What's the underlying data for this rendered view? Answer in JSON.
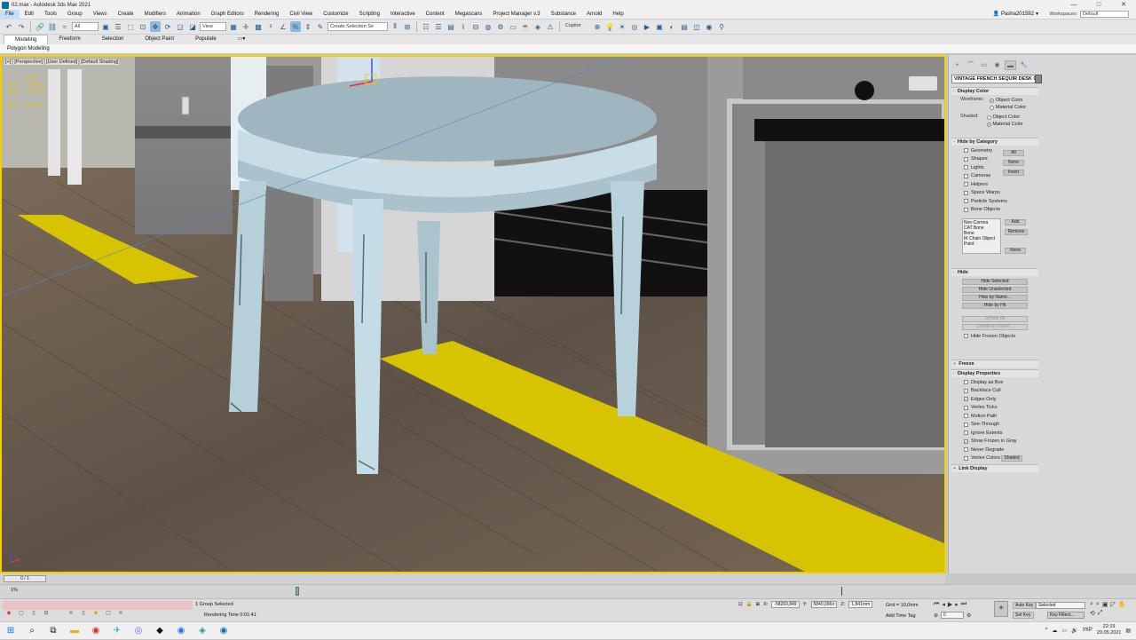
{
  "window": {
    "title": "02.max - Autodesk 3ds Max 2021",
    "min": "—",
    "max": "□",
    "close": "✕"
  },
  "menu": {
    "items": [
      "File",
      "Edit",
      "Tools",
      "Group",
      "Views",
      "Create",
      "Modifiers",
      "Animation",
      "Graph Editors",
      "Rendering",
      "Civil View",
      "Customize",
      "Scripting",
      "Interactive",
      "Content",
      "Megascans",
      "Project Manager v.3",
      "Substance",
      "Arnold",
      "Help"
    ],
    "user": "Pasha201592",
    "workspaces_label": "Workspaces:",
    "workspace": "Default"
  },
  "toolbar": {
    "filter": "All",
    "refcoord": "View",
    "selection_set": "Create Selection Se",
    "copitor": "Copitor"
  },
  "ribbon": {
    "tabs": [
      "Modeling",
      "Freeform",
      "Selection",
      "Object Paint",
      "Populate"
    ],
    "sub": "Polygon Modeling"
  },
  "viewport": {
    "labels": [
      "[+]",
      "[Perspective]",
      "[User Defined]",
      "[Default Shading]"
    ],
    "stats": {
      "total_label": "Total",
      "polys_label": "Polys:",
      "polys": "9 954 72",
      "verts_label": "Verts:",
      "verts": "8 704 95",
      "fps_label": "FPS:",
      "fps": "Inactive"
    },
    "colors": {
      "highlight": "#f0d000",
      "floor": "#6a5e52"
    }
  },
  "cmd": {
    "tabs": [
      "+",
      "⌒",
      "▭",
      "◉",
      "▬",
      "🔧"
    ],
    "object_name": "VINTAGE FRENCH SEQUIR DESK C",
    "display_color": {
      "title": "Display Color",
      "wireframe_label": "Wireframe:",
      "shaded_label": "Shaded:",
      "object_color": "Object Color",
      "material_color": "Material Color"
    },
    "hide_by_category": {
      "title": "Hide by Category",
      "items": [
        "Geometry",
        "Shapes",
        "Lights",
        "Cameras",
        "Helpers",
        "Space Warps",
        "Particle Systems",
        "Bone Objects"
      ],
      "buttons": [
        "All",
        "None",
        "Invert"
      ],
      "list": [
        "Non-Corona",
        "CAT Bone",
        "Bone",
        "IK Chain Object",
        "Point"
      ],
      "list_buttons": [
        "Add",
        "Remove",
        "None"
      ]
    },
    "hide": {
      "title": "Hide",
      "buttons": [
        "Hide Selected",
        "Hide Unselected",
        "Hide by Name...",
        "Hide by Hit"
      ],
      "disabled_buttons": [
        "Unhide All",
        "Unhide by Name..."
      ],
      "frozen": "Hide Frozen Objects"
    },
    "freeze": {
      "title": "Freeze"
    },
    "display_properties": {
      "title": "Display Properties",
      "items": [
        {
          "label": "Display as Box",
          "on": false
        },
        {
          "label": "Backface Cull",
          "on": false
        },
        {
          "label": "Edges Only",
          "on": true
        },
        {
          "label": "Vertex Ticks",
          "on": false
        },
        {
          "label": "Motion Path",
          "on": false
        },
        {
          "label": "See-Through",
          "on": false
        },
        {
          "label": "Ignore Extents",
          "on": false
        },
        {
          "label": "Show Frozen in Gray",
          "on": true
        },
        {
          "label": "Never Degrade",
          "on": false
        },
        {
          "label": "Vertex Colors",
          "on": false
        }
      ],
      "shaded_btn": "Shaded"
    },
    "link_display": {
      "title": "Link Display"
    }
  },
  "timeline": {
    "slider": "0 / 1",
    "pct": "1%"
  },
  "status": {
    "selected": "1 Group Selected",
    "render_time": "Rendering Time  0:01:41",
    "x_label": "X:",
    "x": "-58260,849",
    "y_label": "Y:",
    "y": "5840,096ır",
    "z_label": "Z:",
    "z": "1,841mm",
    "grid": "Grid = 10,0mm",
    "add_time_tag": "Add Time Tag",
    "frame": "0",
    "auto_key": "Auto Key",
    "set_key": "Set Key",
    "selected_dd": "Selected",
    "key_filters": "Key Filters..."
  },
  "taskbar": {
    "lang": "УКР",
    "time": "22:19",
    "date": "29.05.2021"
  }
}
